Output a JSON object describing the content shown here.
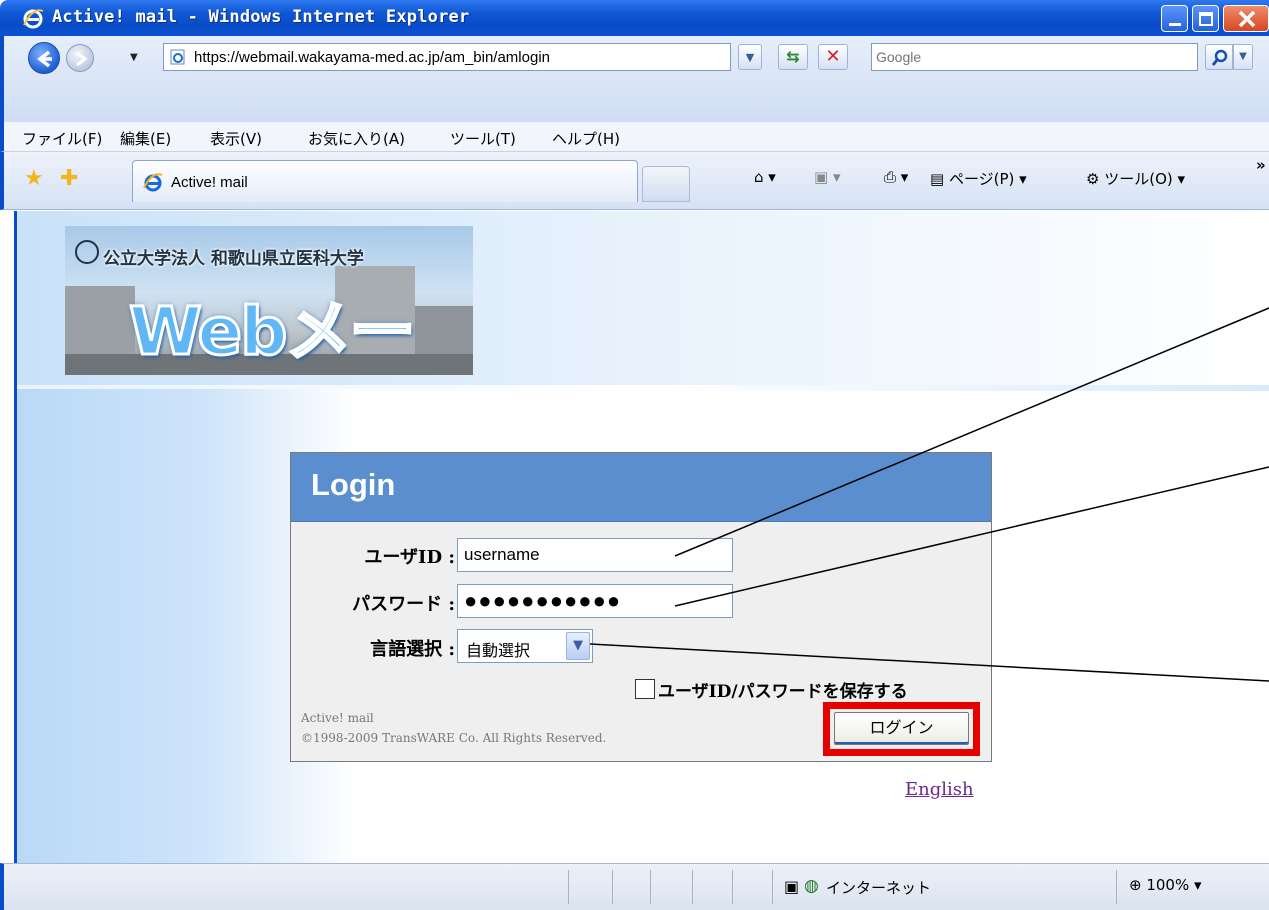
{
  "window": {
    "title": "Active! mail - Windows Internet Explorer"
  },
  "address": {
    "url": "https://webmail.wakayama-med.ac.jp/am_bin/amlogin",
    "search_placeholder": "Google"
  },
  "menu": {
    "items": [
      "ファイル(F)",
      "編集(E)",
      "表示(V)",
      "お気に入り(A)",
      "ツール(T)",
      "ヘルプ(H)"
    ]
  },
  "tabs": {
    "active_label": "Active! mail",
    "page_menu": "ページ(P)",
    "tools_menu": "ツール(O)",
    "more": "»"
  },
  "banner": {
    "university": "公立大学法人 和歌山県立医科大学",
    "webmail": "Webメール"
  },
  "login": {
    "header": "Login",
    "user_label": "ユーザID :",
    "user_value": "username",
    "password_label": "パスワード :",
    "password_value": "●●●●●●●●●●●",
    "language_label": "言語選択 :",
    "language_value": "自動選択",
    "save_label": "ユーザID/パスワードを保存する",
    "footer_product": "Active! mail",
    "footer_copyright": "©1998-2009 TransWARE Co. All Rights Reserved.",
    "login_button": "ログイン",
    "english_link": "English"
  },
  "status": {
    "zone": "インターネット",
    "zoom": "100%"
  },
  "colors": {
    "titlebar": "#0a4cc7",
    "login_header": "#5a8ece",
    "highlight_frame": "#e60000",
    "link_visited": "#6a2a8a"
  }
}
